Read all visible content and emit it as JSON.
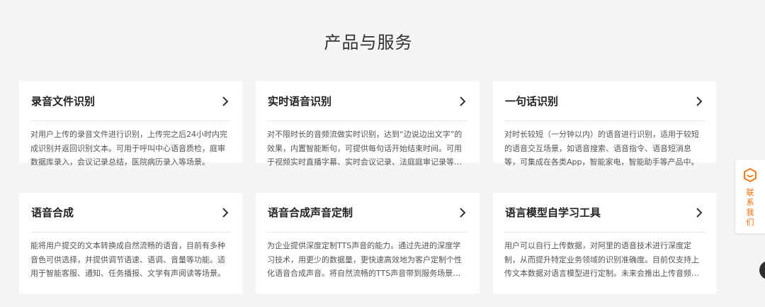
{
  "section": {
    "title": "产品与服务"
  },
  "cards": [
    {
      "title": "录音文件识别",
      "desc": "对用户上传的录音文件进行识别，上传完之后24小时内完成识别并返回识别文本。可用于呼叫中心语音质检，庭审数据库录入，会议记录总结，医院病历录入等场景。"
    },
    {
      "title": "实时语音识别",
      "desc": "对不限时长的音频流做实时识别，达到“边说边出文字”的效果，内置智能断句，可提供每句话开始结束时间。可用于视频实时直播字幕、实时会议记录、法庭庭审记录等场景。"
    },
    {
      "title": "一句话识别",
      "desc": "对时长较短（一分钟以内）的语音进行识别，适用于较短的语音交互场景，如语音搜索、语音指令、语音短消息等，可集成在各类App，智能家电，智能助手等产品中。"
    },
    {
      "title": "语音合成",
      "desc": "能将用户提交的文本转换成自然流畅的语音，目前有多种音色可供选择，并提供调节语速、语调、音量等功能。适用于智能客服、通知、任务播报、文学有声阅读等场景。"
    },
    {
      "title": "语音合成声音定制",
      "desc": "为企业提供深度定制TTS声音的能力。通过先进的深度学习技术，用更少的数据量，更快速高效地为客户定制个性化语音合成声音。将自然流畅的TTS声音带到服务场景中。"
    },
    {
      "title": "语言模型自学习工具",
      "desc": "用户可以自行上传数据，对阿里的语音技术进行深度定制，从而提升特定业务领域的识别准确度。目前仅支持上传文本数据对语言模型进行定制。未来会推出上传音频数据的能力。"
    }
  ],
  "contact": {
    "label": "联系我们",
    "icon": "hexagon-chat-icon"
  },
  "colors": {
    "accent": "#ff6a00",
    "background": "#f5f5f5",
    "card": "#ffffff",
    "title": "#222222",
    "body": "#555555",
    "divider": "#e8e8e8"
  }
}
